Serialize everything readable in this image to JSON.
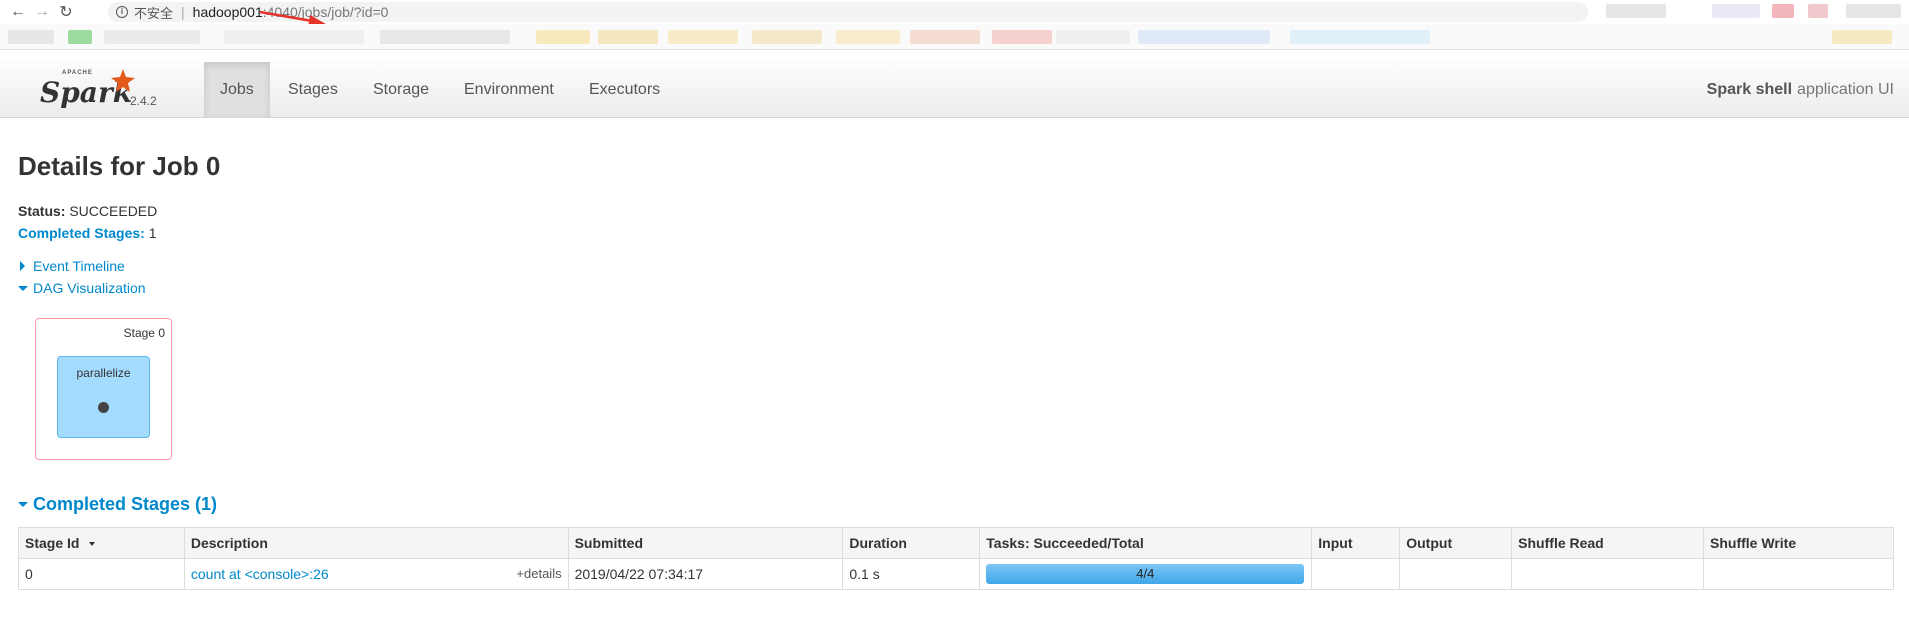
{
  "browser": {
    "back_icon": "←",
    "forward_icon": "→",
    "reload_icon": "↻",
    "security_label": "不安全",
    "url_host": "hadoop001",
    "url_path": ":4040/jobs/job/?id=0"
  },
  "navbar": {
    "brand_apache": "APACHE",
    "brand_word": "Spark",
    "version": "2.4.2",
    "tabs": [
      {
        "label": "Jobs",
        "active": true
      },
      {
        "label": "Stages",
        "active": false
      },
      {
        "label": "Storage",
        "active": false
      },
      {
        "label": "Environment",
        "active": false
      },
      {
        "label": "Executors",
        "active": false
      }
    ],
    "app_name": "Spark shell",
    "app_suffix": "application UI"
  },
  "job": {
    "title": "Details for Job 0",
    "status_label": "Status:",
    "status_value": "SUCCEEDED",
    "completed_stages_label": "Completed Stages:",
    "completed_stages_value": "1",
    "event_timeline": "Event Timeline",
    "dag_visualization": "DAG Visualization"
  },
  "dag": {
    "stage_label": "Stage 0",
    "rdd_label": "parallelize"
  },
  "completed_stages": {
    "header": "Completed Stages (1)",
    "columns": [
      "Stage Id",
      "Description",
      "Submitted",
      "Duration",
      "Tasks: Succeeded/Total",
      "Input",
      "Output",
      "Shuffle Read",
      "Shuffle Write"
    ],
    "rows": [
      {
        "stage_id": "0",
        "description": "count at <console>:26",
        "details": "+details",
        "submitted": "2019/04/22 07:34:17",
        "duration": "0.1 s",
        "tasks": "4/4",
        "tasks_fraction": 1.0,
        "input": "",
        "output": "",
        "shuffle_read": "",
        "shuffle_write": ""
      }
    ]
  },
  "colors": {
    "link": "#0088cc",
    "dag_stage_border": "#ff99aa",
    "dag_rdd_fill": "#a4dcff",
    "progress_bar": "#3fa6e8"
  }
}
